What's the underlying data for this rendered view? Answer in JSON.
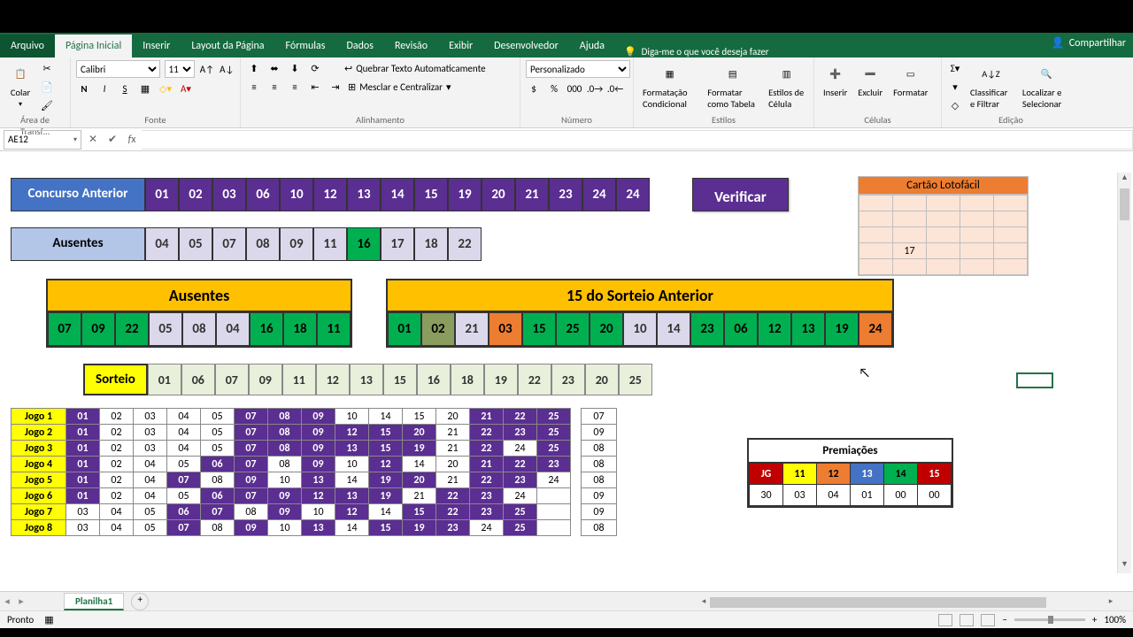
{
  "tabs": {
    "arquivo": "Arquivo",
    "pagina": "Página Inicial",
    "inserir": "Inserir",
    "layout": "Layout da Página",
    "formulas": "Fórmulas",
    "dados": "Dados",
    "revisao": "Revisão",
    "exibir": "Exibir",
    "desenvolvedor": "Desenvolvedor",
    "ajuda": "Ajuda",
    "tellme": "Diga-me o que você deseja fazer",
    "compartilhar": "Compartilhar"
  },
  "ribbon": {
    "clipboard": {
      "colar": "Colar",
      "label": "Área de Transf…"
    },
    "font": {
      "name": "Calibri",
      "size": "11",
      "label": "Fonte"
    },
    "align": {
      "wrap": "Quebrar Texto Automaticamente",
      "merge": "Mesclar e Centralizar",
      "label": "Alinhamento"
    },
    "number": {
      "style": "Personalizado",
      "label": "Número"
    },
    "styles": {
      "cond": "Formatação Condicional",
      "table": "Formatar como Tabela",
      "cell": "Estilos de Célula",
      "label": "Estilos"
    },
    "cells": {
      "ins": "Inserir",
      "del": "Excluir",
      "fmt": "Formatar",
      "label": "Células"
    },
    "editing": {
      "sort": "Classificar e Filtrar",
      "find": "Localizar e Selecionar",
      "label": "Edição"
    }
  },
  "namebox": "AE12",
  "concurso": {
    "header": "Concurso Anterior",
    "nums": [
      "01",
      "02",
      "03",
      "06",
      "10",
      "12",
      "13",
      "14",
      "15",
      "19",
      "20",
      "21",
      "23",
      "24",
      "24"
    ]
  },
  "verify": "Verificar",
  "ausentesRow": {
    "header": "Ausentes",
    "nums": [
      "04",
      "05",
      "07",
      "08",
      "09",
      "11",
      "16",
      "17",
      "18",
      "22"
    ],
    "greenIdx": 6
  },
  "ausentesBox": {
    "title": "Ausentes",
    "cells": [
      {
        "v": "07",
        "c": "green"
      },
      {
        "v": "09",
        "c": "green"
      },
      {
        "v": "22",
        "c": "green"
      },
      {
        "v": "05",
        "c": "lav"
      },
      {
        "v": "08",
        "c": "lav"
      },
      {
        "v": "04",
        "c": "lav"
      },
      {
        "v": "16",
        "c": "green"
      },
      {
        "v": "18",
        "c": "green"
      },
      {
        "v": "11",
        "c": "green"
      }
    ]
  },
  "quinzeBox": {
    "title": "15 do Sorteio Anterior",
    "cells": [
      {
        "v": "01",
        "c": "green"
      },
      {
        "v": "02",
        "c": "dkgreen"
      },
      {
        "v": "21",
        "c": "lav"
      },
      {
        "v": "03",
        "c": "orange"
      },
      {
        "v": "15",
        "c": "green"
      },
      {
        "v": "25",
        "c": "green"
      },
      {
        "v": "20",
        "c": "green"
      },
      {
        "v": "10",
        "c": "lav"
      },
      {
        "v": "14",
        "c": "lav"
      },
      {
        "v": "23",
        "c": "green"
      },
      {
        "v": "06",
        "c": "green"
      },
      {
        "v": "12",
        "c": "green"
      },
      {
        "v": "13",
        "c": "green"
      },
      {
        "v": "19",
        "c": "green"
      },
      {
        "v": "24",
        "c": "orange"
      }
    ]
  },
  "sorteio": {
    "header": "Sorteio",
    "nums": [
      "01",
      "06",
      "07",
      "09",
      "11",
      "12",
      "13",
      "15",
      "16",
      "18",
      "19",
      "22",
      "23",
      "20",
      "25"
    ]
  },
  "jogos": [
    {
      "label": "Jogo 1",
      "n": [
        "01",
        "02",
        "03",
        "04",
        "05",
        "07",
        "08",
        "09",
        "10",
        "14",
        "15",
        "20",
        "21",
        "22",
        "25"
      ],
      "hit": [
        0,
        5,
        6,
        7,
        12,
        13,
        14
      ],
      "ext": "07"
    },
    {
      "label": "Jogo 2",
      "n": [
        "01",
        "02",
        "03",
        "04",
        "05",
        "07",
        "08",
        "09",
        "12",
        "15",
        "20",
        "21",
        "22",
        "23",
        "25"
      ],
      "hit": [
        0,
        5,
        6,
        7,
        8,
        9,
        10,
        12,
        13,
        14
      ],
      "ext": "09"
    },
    {
      "label": "Jogo 3",
      "n": [
        "01",
        "02",
        "03",
        "04",
        "05",
        "07",
        "08",
        "09",
        "13",
        "15",
        "19",
        "21",
        "22",
        "24",
        "25"
      ],
      "hit": [
        0,
        5,
        6,
        7,
        8,
        9,
        10,
        12,
        14
      ],
      "ext": "08"
    },
    {
      "label": "Jogo 4",
      "n": [
        "01",
        "02",
        "04",
        "05",
        "06",
        "07",
        "08",
        "09",
        "10",
        "12",
        "14",
        "20",
        "21",
        "22",
        "23"
      ],
      "hit": [
        0,
        4,
        5,
        7,
        9,
        12,
        13,
        14
      ],
      "ext": "08"
    },
    {
      "label": "Jogo 5",
      "n": [
        "01",
        "02",
        "04",
        "07",
        "08",
        "09",
        "10",
        "13",
        "14",
        "19",
        "20",
        "21",
        "22",
        "23",
        "24"
      ],
      "hit": [
        0,
        3,
        5,
        7,
        9,
        10,
        12,
        13
      ],
      "ext": "08"
    },
    {
      "label": "Jogo 6",
      "n": [
        "01",
        "02",
        "04",
        "05",
        "06",
        "07",
        "09",
        "12",
        "13",
        "19",
        "21",
        "22",
        "23",
        "24"
      ],
      "hit": [
        0,
        4,
        5,
        6,
        7,
        8,
        9,
        11,
        12
      ],
      "ext": "09"
    },
    {
      "label": "Jogo 7",
      "n": [
        "03",
        "04",
        "05",
        "06",
        "07",
        "08",
        "09",
        "10",
        "12",
        "14",
        "15",
        "22",
        "23",
        "25"
      ],
      "hit": [
        3,
        4,
        6,
        8,
        10,
        11,
        12,
        13
      ],
      "ext": "09"
    },
    {
      "label": "Jogo 8",
      "n": [
        "03",
        "04",
        "05",
        "07",
        "08",
        "09",
        "10",
        "13",
        "14",
        "15",
        "19",
        "23",
        "24",
        "25"
      ],
      "hit": [
        3,
        5,
        7,
        9,
        10,
        11,
        13
      ],
      "ext": "08"
    }
  ],
  "premi": {
    "title": "Premiações",
    "head": [
      {
        "v": "JG",
        "bg": "#c00000",
        "fg": "#fff"
      },
      {
        "v": "11",
        "bg": "#ffff00",
        "fg": "#000"
      },
      {
        "v": "12",
        "bg": "#ed7d31",
        "fg": "#000"
      },
      {
        "v": "13",
        "bg": "#4472c4",
        "fg": "#fff"
      },
      {
        "v": "14",
        "bg": "#00b050",
        "fg": "#000"
      },
      {
        "v": "15",
        "bg": "#c00000",
        "fg": "#fff"
      }
    ],
    "row": [
      "30",
      "03",
      "04",
      "01",
      "00",
      "00"
    ]
  },
  "cartao": {
    "title": "Cartão Lotofácil",
    "val17": "17"
  },
  "sheetTab": "Planilha1",
  "status": {
    "ready": "Pronto",
    "zoom": "100%"
  }
}
